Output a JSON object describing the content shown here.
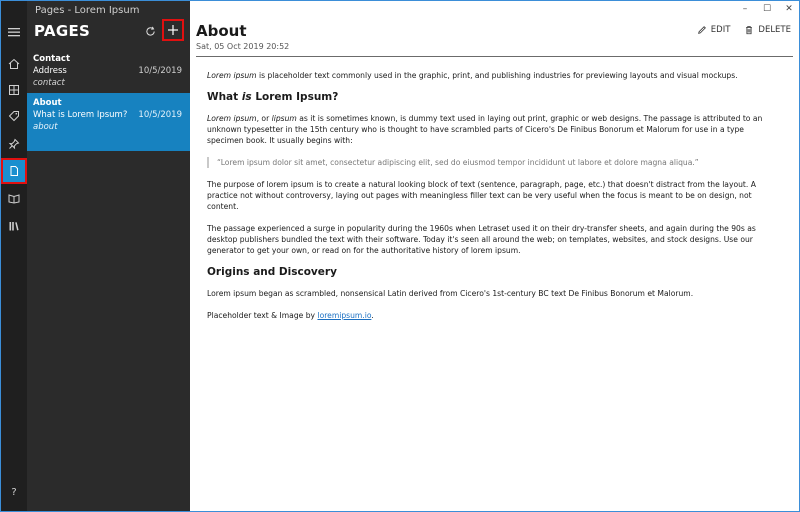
{
  "window": {
    "title": "Pages - Lorem Ipsum",
    "controls": [
      "–",
      "☐",
      "✕"
    ]
  },
  "rail": {
    "icons": [
      "menu-icon",
      "home-icon",
      "calculator-icon",
      "tag-icon",
      "pin-icon",
      "page-icon",
      "read-icon",
      "library-icon"
    ],
    "help": "?"
  },
  "panel": {
    "heading": "PAGES",
    "items": [
      {
        "title": "Contact",
        "subtitle": "Address",
        "tag": "contact",
        "date": "10/5/2019"
      },
      {
        "title": "About",
        "subtitle": "What is Lorem Ipsum?",
        "tag": "about",
        "date": "10/5/2019"
      }
    ]
  },
  "main": {
    "title": "About",
    "date": "Sat, 05 Oct 2019 20:52",
    "edit_label": "EDIT",
    "delete_label": "DELETE",
    "p1_em": "Lorem ipsum",
    "p1_rest": " is placeholder text commonly used in the graphic, print, and publishing industries for previewing layouts and visual mockups.",
    "h1_pre": "What ",
    "h1_em": "is",
    "h1_post": " Lorem Ipsum?",
    "p2_em1": "Lorem ipsum",
    "p2_mid1": ", or ",
    "p2_em2": "lipsum",
    "p2_rest": " as it is sometimes known, is dummy text used in laying out print, graphic or web designs. The passage is attributed to an unknown typesetter in the 15th century who is thought to have scrambled parts of Cicero's De Finibus Bonorum et Malorum for use in a type specimen book. It usually begins with:",
    "quote": "“Lorem ipsum dolor sit amet, consectetur adipiscing elit, sed do eiusmod tempor incididunt ut labore et dolore magna aliqua.”",
    "p3": "The purpose of lorem ipsum is to create a natural looking block of text (sentence, paragraph, page, etc.) that doesn't distract from the layout. A practice not without controversy, laying out pages with meaningless filler text can be very useful when the focus is meant to be on design, not content.",
    "p4": "The passage experienced a surge in popularity during the 1960s when Letraset used it on their dry-transfer sheets, and again during the 90s as desktop publishers bundled the text with their software. Today it's seen all around the web; on templates, websites, and stock designs. Use our generator to get your own, or read on for the authoritative history of lorem ipsum.",
    "h2": "Origins and Discovery",
    "p5": "Lorem ipsum began as scrambled, nonsensical Latin derived from Cicero's 1st-century BC text De Finibus Bonorum et Malorum.",
    "p6_pre": "Placeholder text & Image by ",
    "p6_link": "loremipsum.io",
    "p6_post": "."
  },
  "colors": {
    "accent": "#1782c0",
    "rail_bg": "#1f1f1f",
    "panel_bg": "#2b2b2b",
    "highlight": "#e01010"
  }
}
